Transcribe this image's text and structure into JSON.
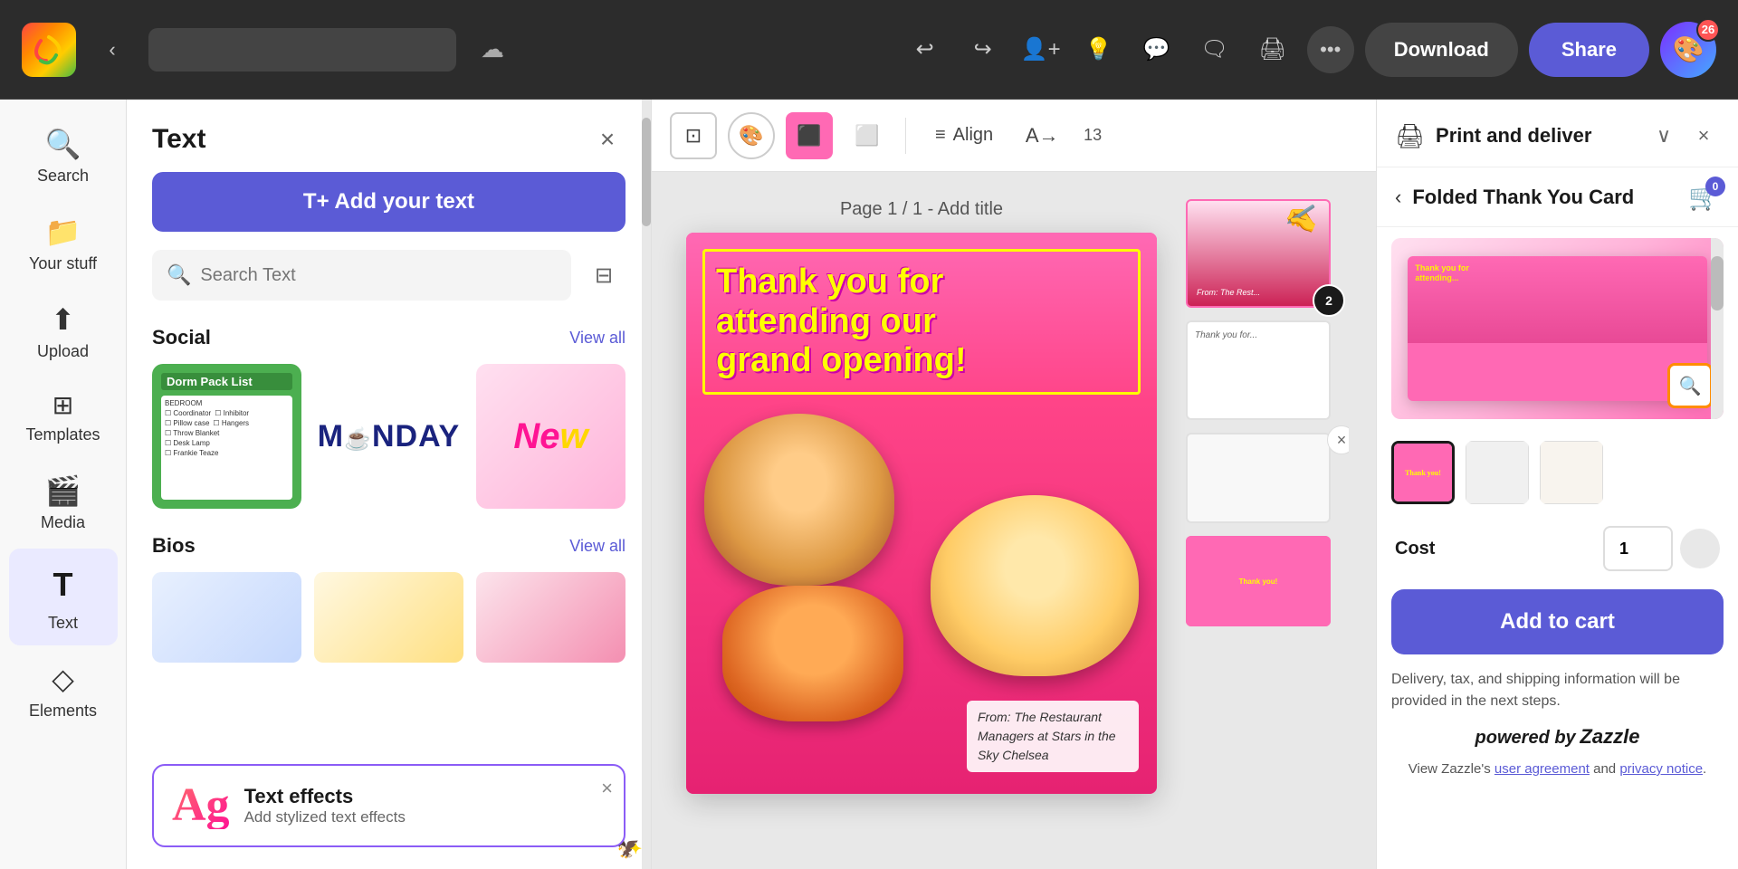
{
  "app": {
    "logo_alt": "Canva logo"
  },
  "topnav": {
    "back_label": "‹",
    "download_label": "Download",
    "share_label": "Share",
    "avatar_badge": "26",
    "more_label": "•••",
    "undo_label": "↩",
    "redo_label": "↪"
  },
  "sidebar": {
    "items": [
      {
        "id": "search",
        "icon": "🔍",
        "label": "Search"
      },
      {
        "id": "your-stuff",
        "icon": "📁",
        "label": "Your stuff"
      },
      {
        "id": "upload",
        "icon": "⬆",
        "label": "Upload"
      },
      {
        "id": "templates",
        "icon": "⊞",
        "label": "Templates"
      },
      {
        "id": "media",
        "icon": "🎬",
        "label": "Media"
      },
      {
        "id": "text",
        "icon": "T",
        "label": "Text",
        "active": true
      },
      {
        "id": "elements",
        "icon": "◇",
        "label": "Elements"
      }
    ]
  },
  "text_panel": {
    "title": "Text",
    "close_label": "×",
    "add_text_label": "T+ Add your text",
    "search_placeholder": "Search Text",
    "filter_label": "⊟",
    "sections": [
      {
        "id": "social",
        "title": "Social",
        "view_all": "View all",
        "templates": [
          {
            "id": "dorm",
            "name": "Dorm Pack List",
            "type": "dorm"
          },
          {
            "id": "monday",
            "name": "Monday",
            "type": "monday"
          },
          {
            "id": "new",
            "name": "New",
            "type": "new"
          }
        ]
      },
      {
        "id": "bios",
        "title": "Bios",
        "view_all": "View all"
      }
    ],
    "text_effects": {
      "ag_label": "Ag",
      "title": "Text effects",
      "subtitle": "Add stylized text effects",
      "close_label": "×"
    }
  },
  "canvas": {
    "page_label": "Page 1 / 1 - Add title",
    "toolbar": {
      "align_label": "Align",
      "char_count": "13"
    }
  },
  "right_panel": {
    "title": "Print and deliver",
    "product_name": "Folded Thank You Card",
    "cart_badge": "0",
    "cost_label": "Cost",
    "quantity": "1",
    "add_to_cart_label": "Add to cart",
    "delivery_note": "Delivery, tax, and shipping information will be provided in the next steps.",
    "powered_by": "powered by",
    "brand": "Zazzle",
    "legal_text": "View Zazzle's",
    "user_agreement": "user agreement",
    "and_text": "and",
    "privacy_notice": "privacy notice"
  },
  "design": {
    "text_line1": "Thank you for",
    "text_line2": "attending our",
    "text_line3": "grand opening!",
    "card_note": "From: The Restaurant Managers at Stars in the Sky Chelsea"
  }
}
